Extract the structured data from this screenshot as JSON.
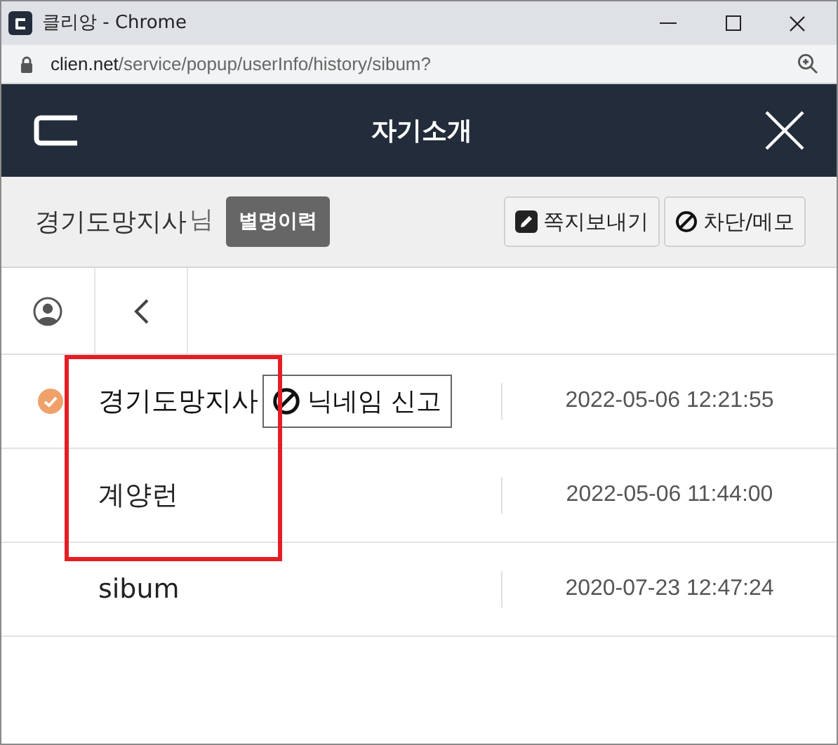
{
  "window": {
    "title": "클리앙 - Chrome",
    "url_host": "clien.net",
    "url_path": "/service/popup/userInfo/history/sibum?"
  },
  "header": {
    "title": "자기소개"
  },
  "profile": {
    "nickname": "경기도망지사",
    "suffix": "님",
    "history_badge": "별명이력",
    "buttons": [
      {
        "kind": "message",
        "label": "쪽지보내기"
      },
      {
        "kind": "block",
        "label": "차단/메모"
      }
    ]
  },
  "history": [
    {
      "name": "경기도망지사",
      "current": true,
      "report_button": "닉네임 신고",
      "time": "2022-05-06 12:21:55"
    },
    {
      "name": "계양런",
      "current": false,
      "time": "2022-05-06 11:44:00"
    },
    {
      "name": "sibum",
      "current": false,
      "time": "2020-07-23 12:47:24"
    }
  ]
}
